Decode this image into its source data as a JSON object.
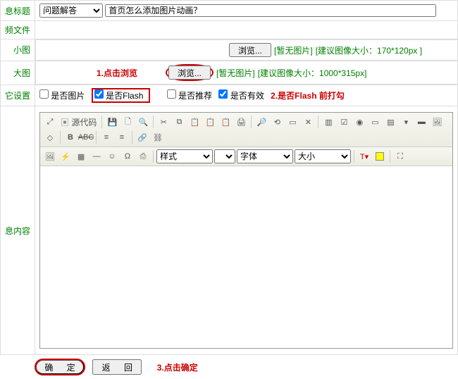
{
  "labels": {
    "title": "息标题",
    "video": "频文件",
    "small": "小图",
    "big": "大图",
    "settings": "它设置",
    "content": "息内容"
  },
  "category": {
    "selected": "问题解答"
  },
  "titleInput": {
    "value": "首页怎么添加图片动画？"
  },
  "browse": "浏览...",
  "smallHint1": "[暂无图片]",
  "smallHint2": "[建议图像大小：170*120px ]",
  "bigHint1": "[暂无图片]",
  "bigHint2": "[建议图像大小：1000*315px]",
  "notes": {
    "n1": "1.点击浏览",
    "n2": "2.是否Flash 前打勾",
    "n3": "3.点击确定"
  },
  "checks": {
    "pic": "是否图片",
    "flash": "是否Flash",
    "rec": "是否推荐",
    "valid": "是否有效"
  },
  "toolbar": {
    "source": "源代码",
    "style": "样式",
    "font": "字体",
    "size": "大小"
  },
  "buttons": {
    "ok": "确  定",
    "back": "返  回"
  }
}
